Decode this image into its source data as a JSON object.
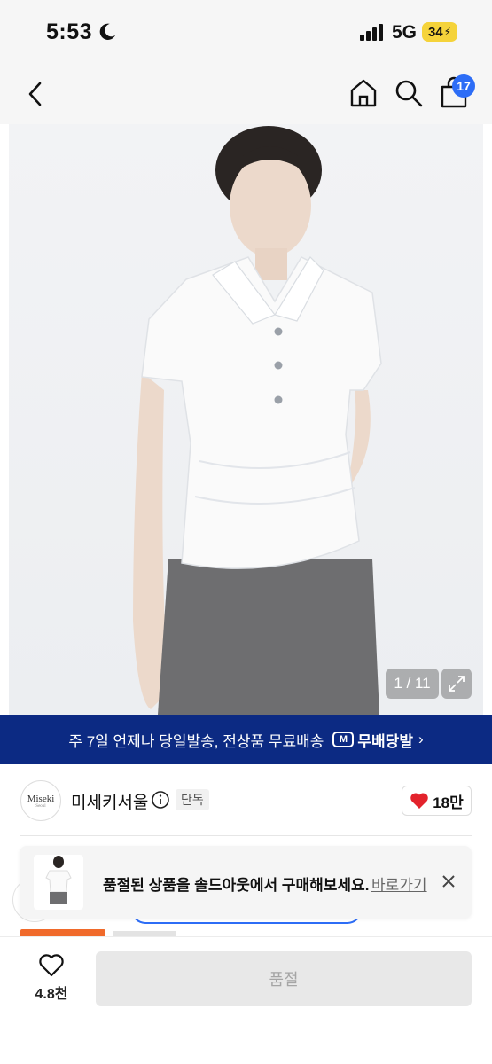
{
  "status_bar": {
    "time": "5:53",
    "network": "5G",
    "battery": "34"
  },
  "nav": {
    "cart_count": "17"
  },
  "gallery": {
    "counter": "1 / 11"
  },
  "promo": {
    "text": "주 7일 언제나 당일발송, 전상품 무료배송",
    "badge_icon_text": "M",
    "badge_label": "무배당발",
    "chevron": "›"
  },
  "shop": {
    "logo_line1": "Miseki",
    "logo_line2": "Seoul",
    "name": "미세키서울",
    "exclusive_tag": "단독",
    "likes": "18만"
  },
  "toast": {
    "message": "품절된 상품을 솔드아웃에서 구매해보세요.",
    "link": "바로가기"
  },
  "bottom_bar": {
    "wish_count": "4.8천",
    "buy_label": "품절"
  },
  "colors": {
    "accent_blue": "#2d6df6",
    "promo_bg": "#0c2a83",
    "heart_red": "#e3232c",
    "battery_yellow": "#f5d33a"
  }
}
